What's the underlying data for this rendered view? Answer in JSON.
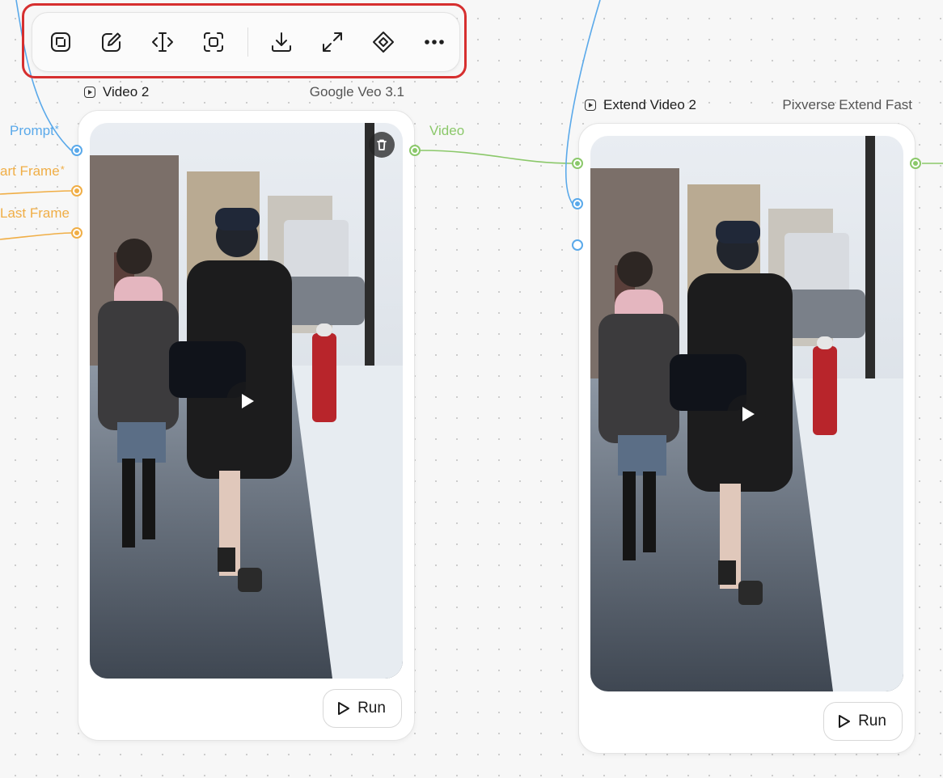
{
  "toolbar": {
    "buttons": [
      {
        "name": "crop-icon"
      },
      {
        "name": "edit-icon"
      },
      {
        "name": "split-icon"
      },
      {
        "name": "focus-icon"
      },
      {
        "name": "download-icon"
      },
      {
        "name": "expand-icon"
      },
      {
        "name": "diamond-icon"
      },
      {
        "name": "more-icon"
      }
    ]
  },
  "nodes": [
    {
      "title": "Video 2",
      "model": "Google Veo 3.1",
      "run_label": "Run",
      "inputs": [
        {
          "label": "Prompt",
          "required": "*",
          "color": "#5aa9ea"
        },
        {
          "label": "art Frame",
          "required": "*",
          "color": "#f0ae46"
        },
        {
          "label": "Last Frame",
          "required": "",
          "color": "#f0ae46"
        }
      ],
      "output": {
        "label": "Video",
        "color": "#8bc86a"
      }
    },
    {
      "title": "Extend Video 2",
      "model": "Pixverse Extend Fast",
      "run_label": "Run"
    }
  ],
  "colors": {
    "prompt_wire": "#5aa9ea",
    "frame_wire": "#f0ae46",
    "video_wire": "#8bc86a",
    "highlight": "#d62f2f"
  }
}
